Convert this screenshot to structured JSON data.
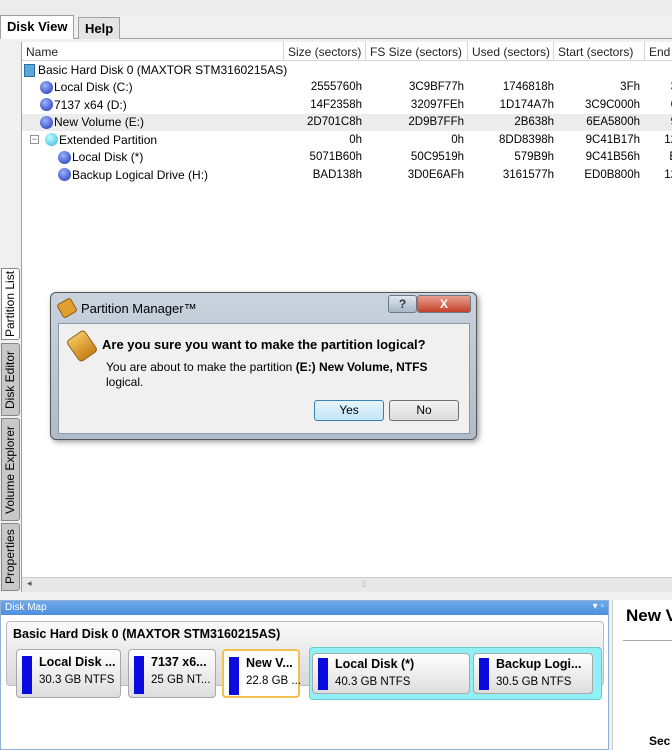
{
  "tabs": [
    "Disk View",
    "Help"
  ],
  "columns": [
    "Name",
    "Size (sectors)",
    "FS Size (sectors)",
    "Used (sectors)",
    "Start (sectors)",
    "End"
  ],
  "disk_name": "Basic Hard Disk 0 (MAXTOR STM3160215AS)",
  "rows": [
    {
      "name": "Local Disk (C:)",
      "size": "2555760h",
      "fs": "3C9BF77h",
      "used": "1746818h",
      "start": "3Fh",
      "end": "3"
    },
    {
      "name": "7137 x64 (D:)",
      "size": "14F2358h",
      "fs": "32097FEh",
      "used": "1D174A7h",
      "start": "3C9C000h",
      "end": "6"
    },
    {
      "name": "New Volume (E:)",
      "size": "2D701C8h",
      "fs": "2D9B7FFh",
      "used": "2B638h",
      "start": "6EA5800h",
      "end": "9"
    },
    {
      "name": "Extended Partition",
      "size": "0h",
      "fs": "0h",
      "used": "8DD8398h",
      "start": "9C41B17h",
      "end": "12"
    },
    {
      "name": "Local Disk (*)",
      "size": "5071B60h",
      "fs": "50C9519h",
      "used": "579B9h",
      "start": "9C41B56h",
      "end": "E"
    },
    {
      "name": "Backup Logical Drive (H:)",
      "size": "BAD138h",
      "fs": "3D0E6AFh",
      "used": "3161577h",
      "start": "ED0B800h",
      "end": "12"
    }
  ],
  "side_tabs": [
    "Partition List",
    "Disk Editor",
    "Volume Explorer",
    "Properties"
  ],
  "disk_map": {
    "title": "Disk Map",
    "disk": "Basic Hard Disk 0 (MAXTOR STM3160215AS)",
    "parts": [
      {
        "name": "Local Disk ...",
        "info": "30.3 GB NTFS"
      },
      {
        "name": "7137 x6...",
        "info": "25 GB NT..."
      },
      {
        "name": "New V...",
        "info": "22.8 GB ..."
      },
      {
        "name": "Local Disk (*)",
        "info": "40.3 GB NTFS"
      },
      {
        "name": "Backup Logi...",
        "info": "30.5 GB NTFS"
      }
    ]
  },
  "right_panel": {
    "title": "New V",
    "footer": "Sec"
  },
  "dialog": {
    "title": "Partition Manager™",
    "question": "Are you sure you want to make the partition logical?",
    "msg_pre": "You are about to make the partition ",
    "msg_bold": "(E:) New Volume, NTFS",
    "msg_post": " logical.",
    "yes": "Yes",
    "no": "No",
    "help": "?",
    "close": "X"
  }
}
